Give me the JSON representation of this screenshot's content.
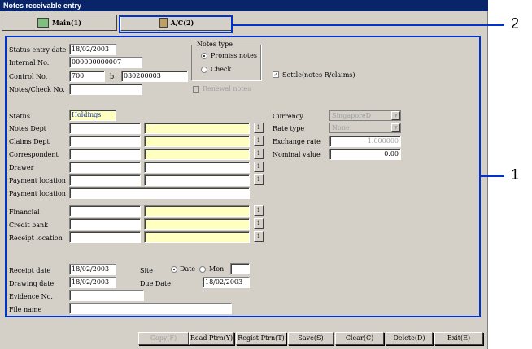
{
  "window": {
    "title": "Notes receivable entry"
  },
  "tabs": [
    {
      "label": "Main(1)"
    },
    {
      "label": "A/C(2)"
    }
  ],
  "callouts": {
    "one": "1",
    "two": "2"
  },
  "labels": {
    "status_entry_date": "Status entry date",
    "internal_no": "Internal No.",
    "control_no": "Control No.",
    "notes_check_no": "Notes/Check No.",
    "notes_type": "Notes type",
    "promiss_notes": "Promiss notes",
    "check": "Check",
    "renewal_notes": "Renewal notes",
    "settle": "Settle(notes R/claims)",
    "status": "Status",
    "notes_dept": "Notes Dept",
    "claims_dept": "Claims Dept",
    "correspondent": "Correspondent",
    "drawer": "Drawer",
    "payment_location": "Payment location",
    "payment_location2": "Payment location",
    "financial": "Financial",
    "credit_bank": "Credit bank",
    "receipt_location": "Receipt location",
    "currency": "Currency",
    "rate_type": "Rate type",
    "exchange_rate": "Exchange rate",
    "nominal_value": "Nominal value",
    "receipt_date": "Receipt date",
    "drawing_date": "Drawing date",
    "evidence_no": "Evidence No.",
    "file_name": "File name",
    "site": "Site",
    "date": "Date",
    "mon": "Mon",
    "due_date": "Due Date",
    "b": "b",
    "btn_1": "1"
  },
  "values": {
    "status_entry_date": "18/02/2003",
    "internal_no": "000000000007",
    "control_no_a": "700",
    "control_no_b": "030200003",
    "status": "Holdings",
    "currency": "SingaporeD",
    "rate_type": "None",
    "exchange_rate": "1.000000",
    "nominal_value": "0.00",
    "receipt_date": "18/02/2003",
    "drawing_date": "18/02/2003",
    "due_date": "18/02/2003",
    "settle_checked": "✓"
  },
  "buttons": {
    "copy": "Copy(F)",
    "read_ptrn": "Read Ptrn(Y)",
    "regist_ptrn": "Regist Ptrn(T)",
    "save": "Save(S)",
    "clear": "Clear(C)",
    "delete": "Delete(D)",
    "exit": "Exit(E)"
  }
}
